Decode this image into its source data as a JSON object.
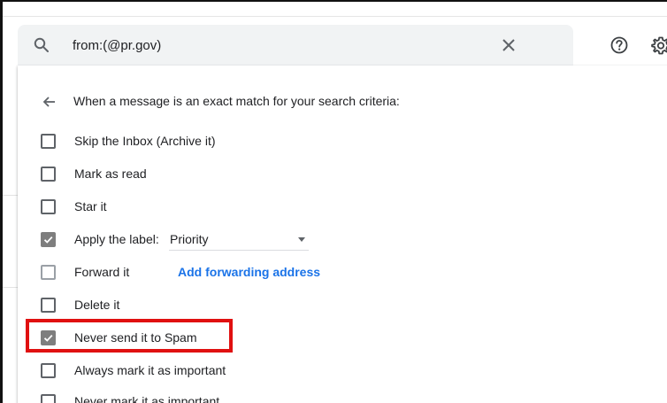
{
  "search": {
    "query": "from:(@pr.gov)"
  },
  "filter_panel": {
    "heading": "When a message is an exact match for your search criteria:",
    "options": [
      {
        "label": "Skip the Inbox (Archive it)",
        "checked": false
      },
      {
        "label": "Mark as read",
        "checked": false
      },
      {
        "label": "Star it",
        "checked": false
      },
      {
        "label": "Apply the label:",
        "checked": true,
        "selected_label": "Priority"
      },
      {
        "label": "Forward it",
        "checked": false,
        "link": "Add forwarding address"
      },
      {
        "label": "Delete it",
        "checked": false
      },
      {
        "label": "Never send it to Spam",
        "checked": true,
        "highlighted": true
      },
      {
        "label": "Always mark it as important",
        "checked": false
      },
      {
        "label": "Never mark it as important",
        "checked": false
      }
    ]
  },
  "icons": {
    "search": "search-icon",
    "clear": "close-icon",
    "help": "help-circle-icon",
    "settings": "gear-icon",
    "back": "arrow-left-icon",
    "dropdown": "dropdown-arrow-icon"
  },
  "colors": {
    "link": "#1a73e8",
    "highlight": "#e01010",
    "checked_box": "#7e7e7e",
    "search_bg": "#f1f3f4"
  }
}
